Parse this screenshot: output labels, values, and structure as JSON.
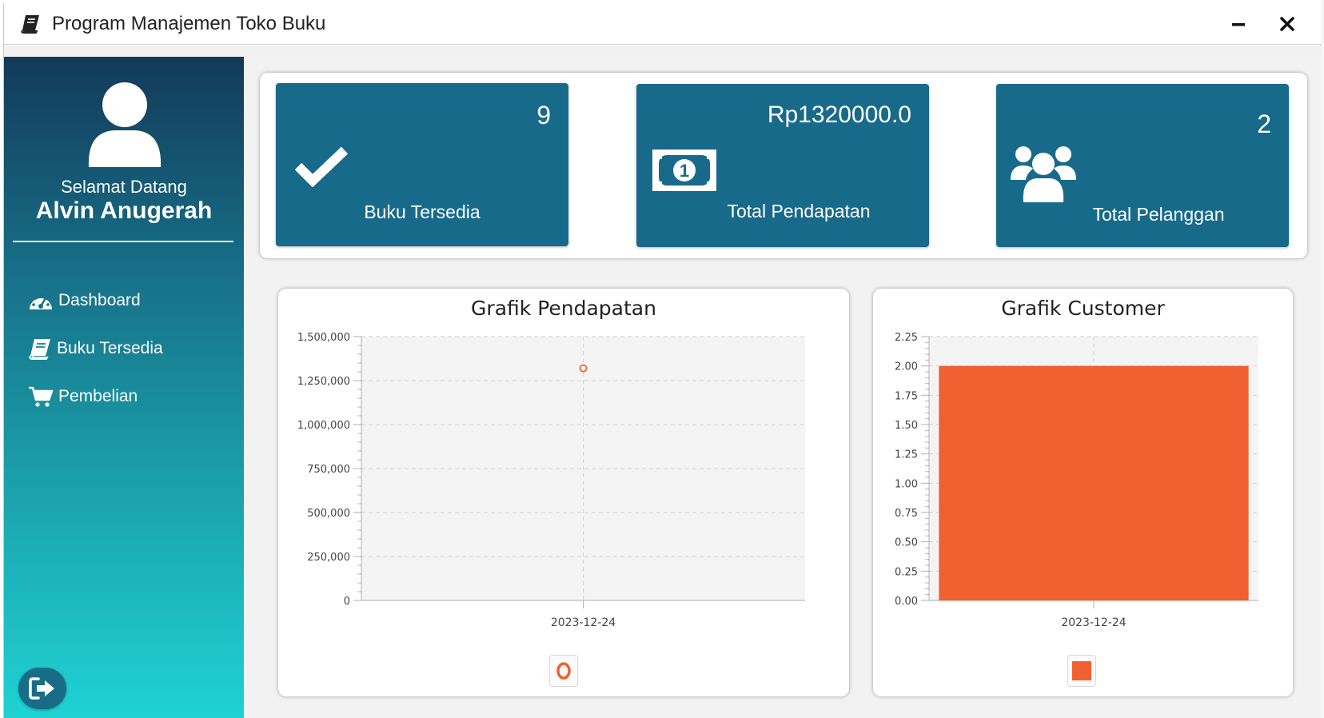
{
  "window": {
    "title": "Program Manajemen Toko Buku"
  },
  "sidebar": {
    "welcome": "Selamat Datang",
    "username": "Alvin Anugerah",
    "items": [
      {
        "label": "Dashboard",
        "icon": "dashboard-gauge-icon"
      },
      {
        "label": "Buku Tersedia",
        "icon": "book-icon"
      },
      {
        "label": "Pembelian",
        "icon": "cart-icon"
      }
    ],
    "logout_icon": "logout-icon"
  },
  "stats": [
    {
      "value": "9",
      "label": "Buku Tersedia",
      "icon": "check-icon"
    },
    {
      "value": "Rp1320000.0",
      "label": "Total Pendapatan",
      "icon": "money-bill-icon"
    },
    {
      "value": "2",
      "label": "Total Pelanggan",
      "icon": "users-icon"
    }
  ],
  "colors": {
    "card": "#186a8a",
    "series": "#f06030",
    "sidebar_top": "#123a59",
    "sidebar_bottom": "#1fd2d4"
  },
  "chart_data": [
    {
      "type": "line",
      "title": "Grafik Pendapatan",
      "categories": [
        "2023-12-24"
      ],
      "series": [
        {
          "values": [
            1320000
          ]
        }
      ],
      "ylim": [
        0,
        1500000
      ],
      "yticks": [
        0,
        250000,
        500000,
        750000,
        1000000,
        1250000,
        1500000
      ],
      "ytick_labels": [
        "0",
        "250,000",
        "500,000",
        "750,000",
        "1,000,000",
        "1,250,000",
        "1,500,000"
      ],
      "grid": true,
      "legend": "bottom",
      "legend_symbol": "circle"
    },
    {
      "type": "bar",
      "title": "Grafik Customer",
      "categories": [
        "2023-12-24"
      ],
      "series": [
        {
          "values": [
            2
          ]
        }
      ],
      "ylim": [
        0,
        2.25
      ],
      "yticks": [
        0,
        0.25,
        0.5,
        0.75,
        1.0,
        1.25,
        1.5,
        1.75,
        2.0,
        2.25
      ],
      "ytick_labels": [
        "0.00",
        "0.25",
        "0.50",
        "0.75",
        "1.00",
        "1.25",
        "1.50",
        "1.75",
        "2.00",
        "2.25"
      ],
      "grid": true,
      "legend": "bottom",
      "legend_symbol": "square"
    }
  ]
}
